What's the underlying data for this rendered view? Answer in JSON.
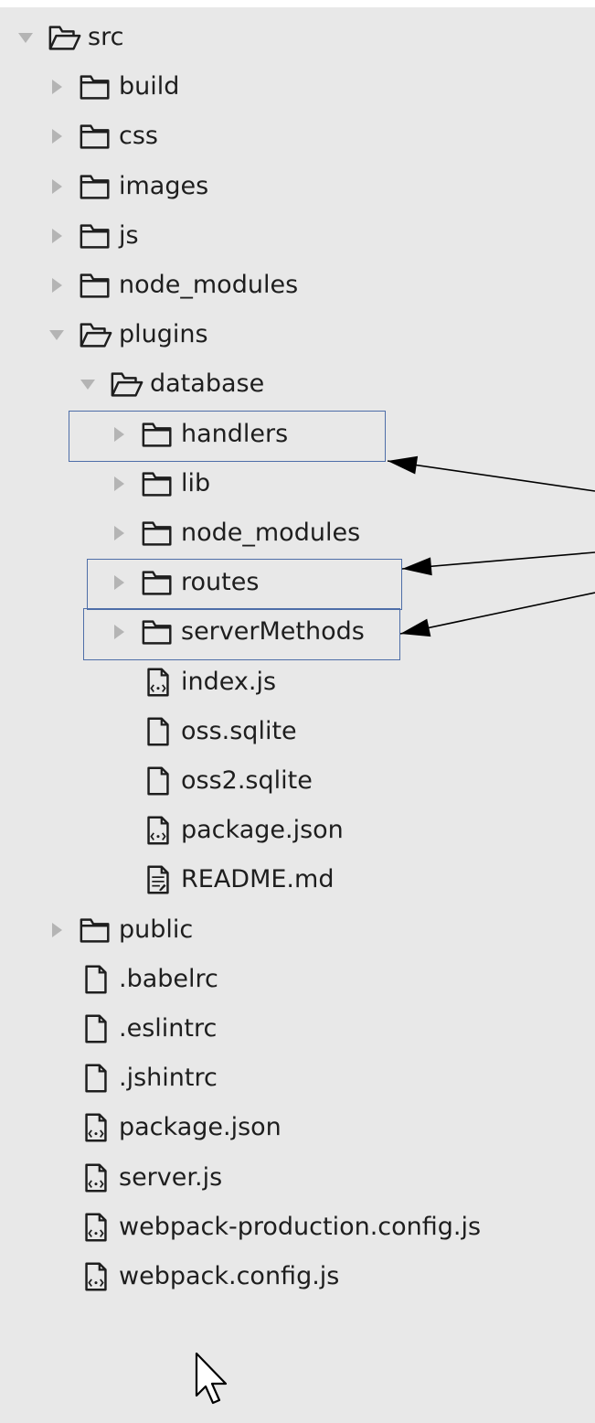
{
  "tree": [
    {
      "label": "src",
      "type": "folder",
      "expanded": true,
      "depth": 0,
      "name": "tree-item-src"
    },
    {
      "label": "build",
      "type": "folder",
      "expanded": false,
      "depth": 1,
      "name": "tree-item-build"
    },
    {
      "label": "css",
      "type": "folder",
      "expanded": false,
      "depth": 1,
      "name": "tree-item-css"
    },
    {
      "label": "images",
      "type": "folder",
      "expanded": false,
      "depth": 1,
      "name": "tree-item-images"
    },
    {
      "label": "js",
      "type": "folder",
      "expanded": false,
      "depth": 1,
      "name": "tree-item-js"
    },
    {
      "label": "node_modules",
      "type": "folder",
      "expanded": false,
      "depth": 1,
      "name": "tree-item-node-modules"
    },
    {
      "label": "plugins",
      "type": "folder",
      "expanded": true,
      "depth": 1,
      "name": "tree-item-plugins"
    },
    {
      "label": "database",
      "type": "folder",
      "expanded": true,
      "depth": 2,
      "name": "tree-item-database"
    },
    {
      "label": "handlers",
      "type": "folder",
      "expanded": false,
      "depth": 3,
      "highlighted": true,
      "name": "tree-item-handlers"
    },
    {
      "label": "lib",
      "type": "folder",
      "expanded": false,
      "depth": 3,
      "name": "tree-item-lib"
    },
    {
      "label": "node_modules",
      "type": "folder",
      "expanded": false,
      "depth": 3,
      "name": "tree-item-database-node-modules"
    },
    {
      "label": "routes",
      "type": "folder",
      "expanded": false,
      "depth": 3,
      "highlighted": true,
      "name": "tree-item-routes"
    },
    {
      "label": "serverMethods",
      "type": "folder",
      "expanded": false,
      "depth": 3,
      "highlighted": true,
      "name": "tree-item-servermethods"
    },
    {
      "label": "index.js",
      "type": "file-code",
      "depth": 3,
      "name": "tree-item-index-js"
    },
    {
      "label": "oss.sqlite",
      "type": "file",
      "depth": 3,
      "name": "tree-item-oss-sqlite"
    },
    {
      "label": "oss2.sqlite",
      "type": "file",
      "depth": 3,
      "name": "tree-item-oss2-sqlite"
    },
    {
      "label": "package.json",
      "type": "file-code",
      "depth": 3,
      "name": "tree-item-database-package-json"
    },
    {
      "label": "README.md",
      "type": "file-text",
      "depth": 3,
      "name": "tree-item-readme-md"
    },
    {
      "label": "public",
      "type": "folder",
      "expanded": false,
      "depth": 1,
      "name": "tree-item-public"
    },
    {
      "label": ".babelrc",
      "type": "file",
      "depth": 1,
      "name": "tree-item-babelrc"
    },
    {
      "label": ".eslintrc",
      "type": "file",
      "depth": 1,
      "name": "tree-item-eslintrc"
    },
    {
      "label": ".jshintrc",
      "type": "file",
      "depth": 1,
      "name": "tree-item-jshintrc"
    },
    {
      "label": "package.json",
      "type": "file-code",
      "depth": 1,
      "name": "tree-item-package-json"
    },
    {
      "label": "server.js",
      "type": "file-code",
      "depth": 1,
      "name": "tree-item-server-js"
    },
    {
      "label": "webpack-production.config.js",
      "type": "file-code",
      "depth": 1,
      "name": "tree-item-webpack-production-config-js"
    },
    {
      "label": "webpack.config.js",
      "type": "file-code",
      "depth": 1,
      "name": "tree-item-webpack-config-js"
    }
  ],
  "colors": {
    "background": "#e8e8e8",
    "text": "#1e1e1e",
    "highlight_border": "#4e6ea8",
    "twisty": "#b4b4b4",
    "icon_stroke": "#1e1e1e",
    "arrow": "#000000"
  },
  "icons": {
    "folder_closed": "folder-icon",
    "folder_open": "folder-open-icon",
    "file": "file-icon",
    "file_code": "code-file-icon",
    "file_text": "text-file-icon",
    "twisty_collapsed": "chevron-right-icon",
    "twisty_expanded": "chevron-down-icon",
    "cursor": "mouse-pointer-icon"
  }
}
